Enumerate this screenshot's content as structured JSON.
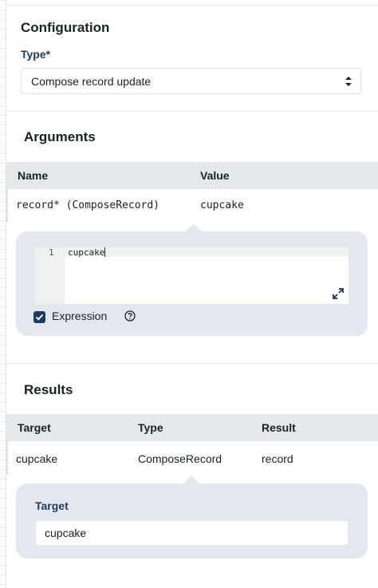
{
  "configuration": {
    "title": "Configuration",
    "type_label": "Type*",
    "type_value": "Compose record update"
  },
  "arguments": {
    "title": "Arguments",
    "columns": [
      "Name",
      "Value"
    ],
    "row": {
      "name": "record* (ComposeRecord)",
      "value": "cupcake"
    },
    "editor": {
      "line_number": "1",
      "code": "cupcake"
    },
    "expression_label": "Expression",
    "expression_checked": true
  },
  "results": {
    "title": "Results",
    "columns": [
      "Target",
      "Type",
      "Result"
    ],
    "row": {
      "target": "cupcake",
      "type": "ComposeRecord",
      "result": "record"
    },
    "target_label": "Target",
    "target_value": "cupcake"
  },
  "colors": {
    "label_blue": "#1e3a5c",
    "table_header_bg": "#e4e8ec",
    "bubble_bg": "#e4e8ee"
  }
}
